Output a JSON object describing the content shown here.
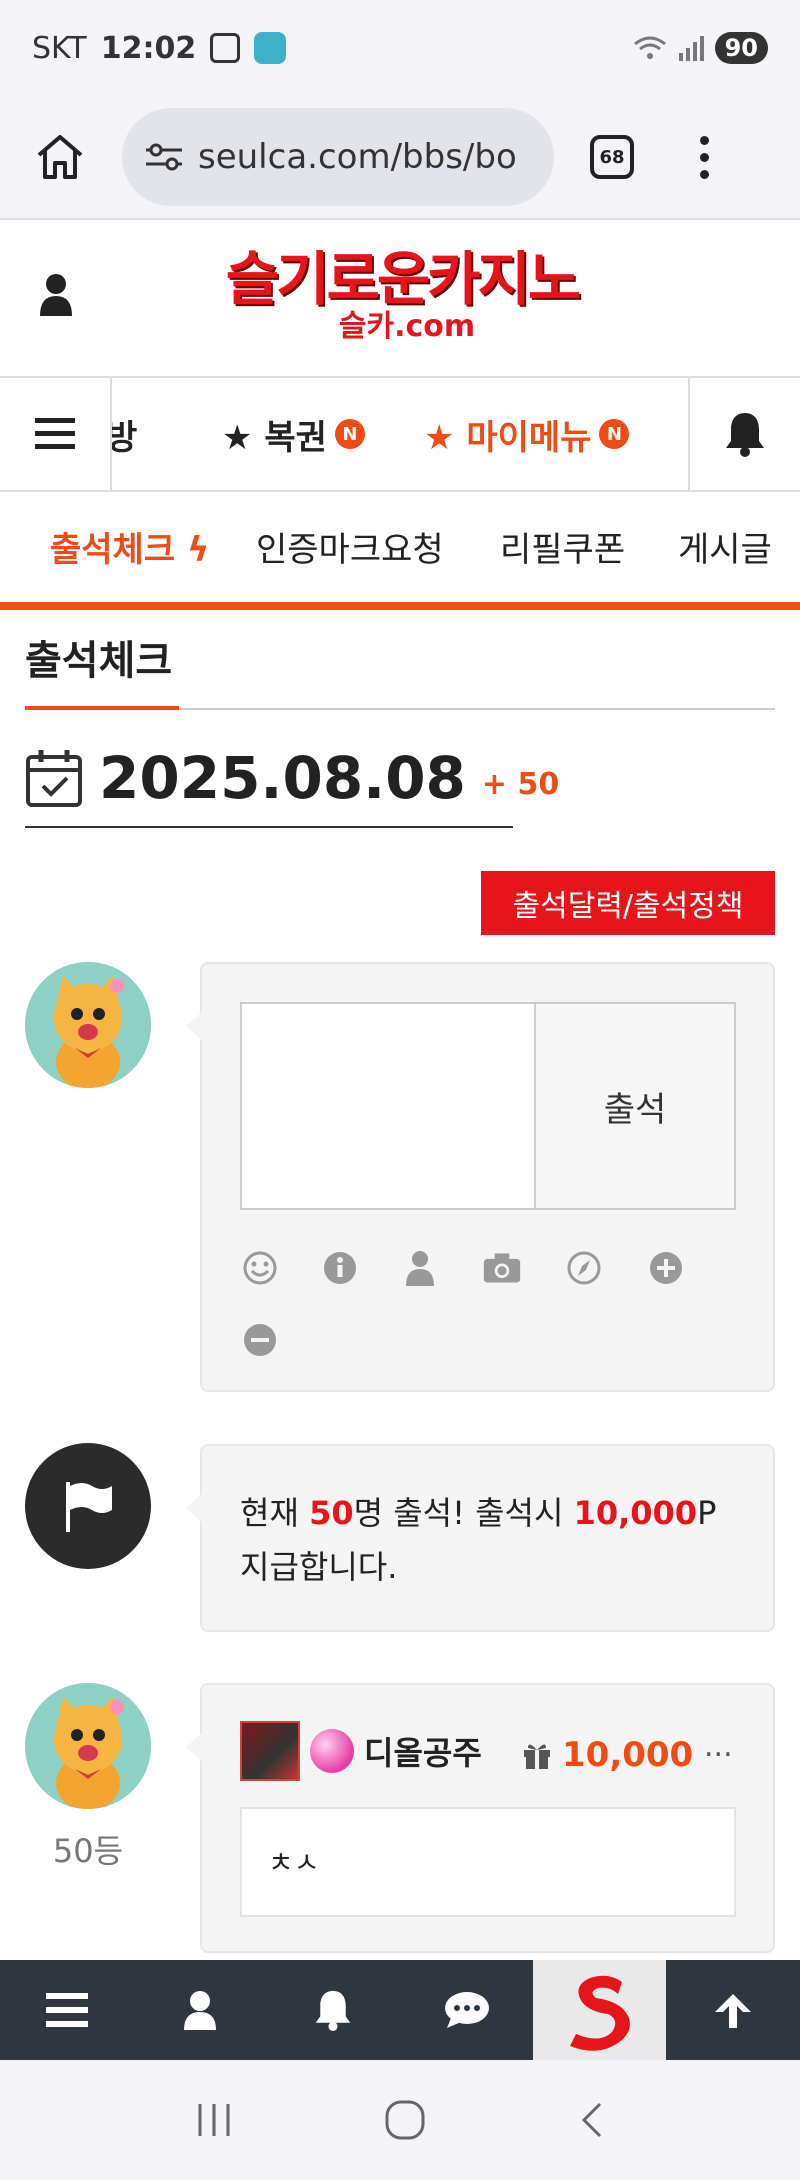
{
  "status_bar": {
    "carrier": "SKT",
    "time": "12:02",
    "battery": "90"
  },
  "browser": {
    "url": "seulca.com/bbs/bo",
    "tab_count": "68"
  },
  "site": {
    "logo_main": "슬기로운카지노",
    "logo_sub": "슬카.com",
    "nav_items": [
      {
        "label": "방",
        "badge": ""
      },
      {
        "label": "★ 복권",
        "badge": "N"
      },
      {
        "label": "★ 마이메뉴",
        "badge": "N"
      }
    ],
    "sub_nav": [
      {
        "label": "출석체크",
        "active": true
      },
      {
        "label": "인증마크요청",
        "active": false
      },
      {
        "label": "리필쿠폰",
        "active": false
      },
      {
        "label": "게시글",
        "active": false
      }
    ]
  },
  "page": {
    "title": "출석체크",
    "date": "2025.08.08",
    "date_plus": "+ 50",
    "policy_button": "출석달력/출석정책",
    "compose": {
      "submit_label": "출석",
      "textarea_value": ""
    },
    "notice": {
      "prefix": "현재 ",
      "count": "50",
      "mid": "명 출석! 출석시 ",
      "points": "10,000",
      "suffix": "P",
      "line2": "지급합니다."
    },
    "comments": [
      {
        "rank": "50등",
        "nickname": "디올공주",
        "points": "10,000",
        "more": "...",
        "text": "ㅊㅅ"
      }
    ]
  },
  "colors": {
    "accent": "#ee4b15",
    "brand_red": "#e8141c",
    "tabbar_bg": "#2f3640"
  },
  "icons": {
    "toolbar": [
      "smile-icon",
      "info-icon",
      "user-icon",
      "camera-icon",
      "compass-icon",
      "plus-circle-icon",
      "minus-circle-icon"
    ],
    "tabbar": [
      "menu-icon",
      "user-icon",
      "bell-icon",
      "chat-icon",
      "site-logo",
      "arrow-up-icon"
    ]
  }
}
